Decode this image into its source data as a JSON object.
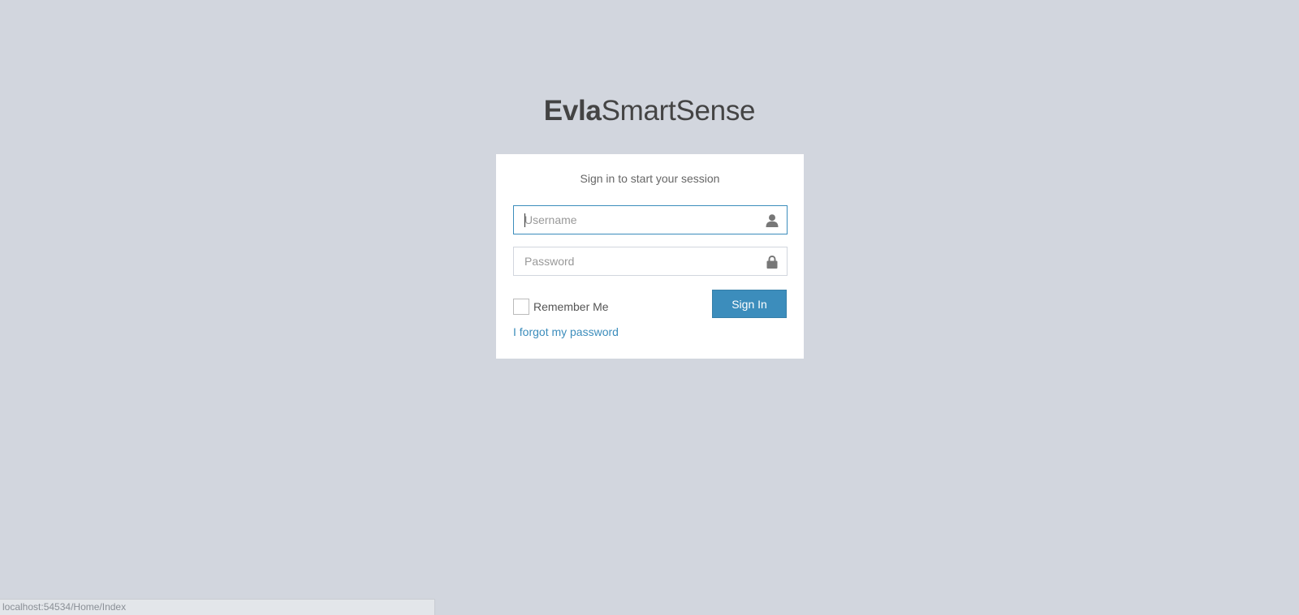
{
  "brand": {
    "bold": "Evla",
    "light": "SmartSense"
  },
  "login": {
    "message": "Sign in to start your session",
    "username": {
      "placeholder": "Username",
      "value": "",
      "icon": "user-icon"
    },
    "password": {
      "placeholder": "Password",
      "value": "",
      "icon": "lock-icon"
    },
    "remember_label": "Remember Me",
    "remember_checked": false,
    "signin_label": "Sign In",
    "forgot_label": "I forgot my password"
  },
  "status_bar": {
    "url": "localhost:54534/Home/Index"
  },
  "colors": {
    "background": "#d2d6de",
    "accent": "#3c8dbc",
    "box": "#ffffff",
    "text_dark": "#444444"
  }
}
